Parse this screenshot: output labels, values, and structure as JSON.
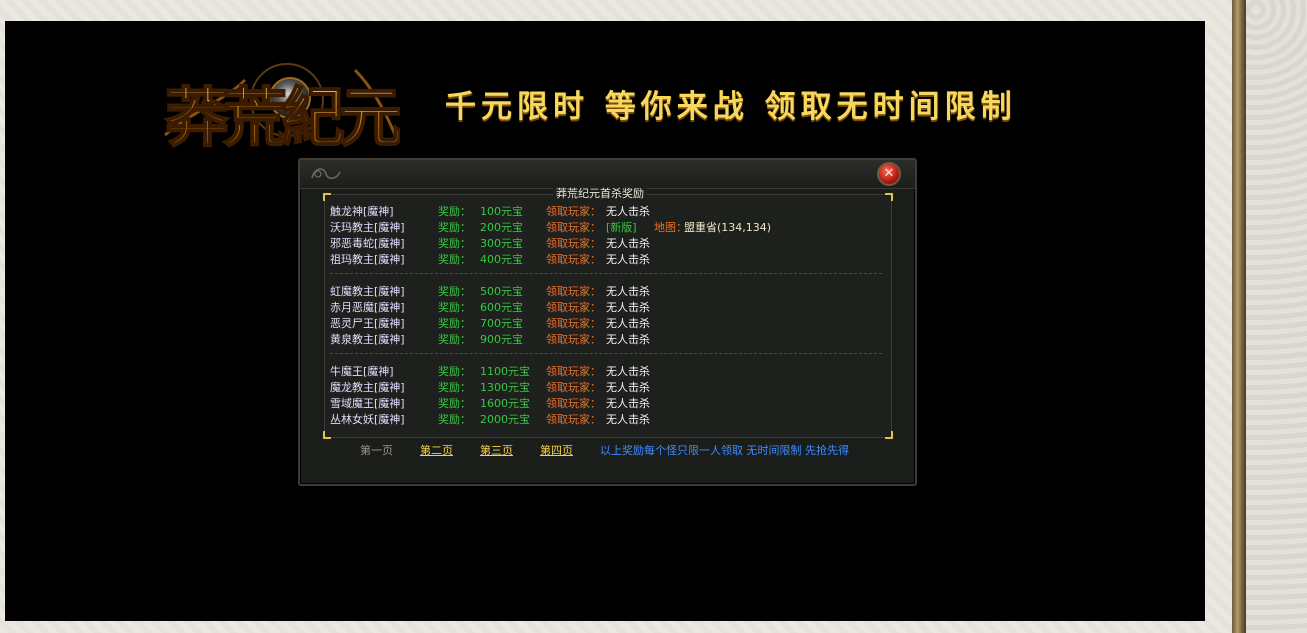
{
  "slogan": "千元限时 等你来战 领取无时间限制",
  "logo_text": "莽荒纪元",
  "dialog": {
    "title": "莽荒纪元首杀奖励",
    "close_symbol": "✕",
    "reward_label": "奖励：",
    "claim_label": "领取玩家：",
    "groups": [
      [
        {
          "boss": "触龙神[魔神]",
          "reward": "100元宝",
          "claimer": "无人击杀"
        },
        {
          "boss": "沃玛教主[魔神]",
          "reward": "200元宝",
          "claimer": "[新版]",
          "map_label": "地图：",
          "map": "盟重省(134,134)"
        },
        {
          "boss": "邪恶毒蛇[魔神]",
          "reward": "300元宝",
          "claimer": "无人击杀"
        },
        {
          "boss": "祖玛教主[魔神]",
          "reward": "400元宝",
          "claimer": "无人击杀"
        }
      ],
      [
        {
          "boss": "虹魔教主[魔神]",
          "reward": "500元宝",
          "claimer": "无人击杀"
        },
        {
          "boss": "赤月恶魔[魔神]",
          "reward": "600元宝",
          "claimer": "无人击杀"
        },
        {
          "boss": "恶灵尸王[魔神]",
          "reward": "700元宝",
          "claimer": "无人击杀"
        },
        {
          "boss": "黄泉教主[魔神]",
          "reward": "900元宝",
          "claimer": "无人击杀"
        }
      ],
      [
        {
          "boss": "牛魔王[魔神]",
          "reward": "1100元宝",
          "claimer": "无人击杀"
        },
        {
          "boss": "魔龙教主[魔神]",
          "reward": "1300元宝",
          "claimer": "无人击杀"
        },
        {
          "boss": "雪域魔王[魔神]",
          "reward": "1600元宝",
          "claimer": "无人击杀"
        },
        {
          "boss": "丛林女妖[魔神]",
          "reward": "2000元宝",
          "claimer": "无人击杀"
        }
      ]
    ],
    "pager": {
      "current": "第一页",
      "page2": "第二页",
      "page3": "第三页",
      "page4": "第四页"
    },
    "notice": "以上奖励每个怪只限一人领取 无时间限制 先抢先得"
  },
  "colors": {
    "slogan": "#f7d85e",
    "boss": "#e3dafc",
    "reward": "#36c843",
    "claim_label": "#ef6e2a",
    "page_link": "#f6d44a",
    "notice": "#3f8cff"
  }
}
